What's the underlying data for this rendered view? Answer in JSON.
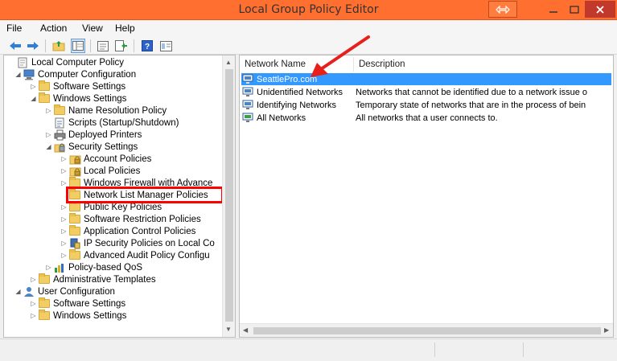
{
  "window": {
    "title": "Local Group Policy Editor"
  },
  "menu": [
    "File",
    "Action",
    "View",
    "Help"
  ],
  "toolbar": [
    "back-icon",
    "forward-icon",
    "up-folder-icon",
    "show-tree-icon",
    "properties-icon",
    "export-list-icon",
    "help-icon",
    "extended-view-icon"
  ],
  "tree": [
    {
      "label": "Local Computer Policy",
      "expander": "",
      "icon": "policy",
      "indent": 0
    },
    {
      "label": "Computer Configuration",
      "expander": "◢",
      "icon": "computer",
      "indent": 1
    },
    {
      "label": "Software Settings",
      "expander": "▷",
      "icon": "folder",
      "indent": 2
    },
    {
      "label": "Windows Settings",
      "expander": "◢",
      "icon": "folder",
      "indent": 2
    },
    {
      "label": "Name Resolution Policy",
      "expander": "▷",
      "icon": "folder",
      "indent": 3
    },
    {
      "label": "Scripts (Startup/Shutdown)",
      "expander": "",
      "icon": "script",
      "indent": 3
    },
    {
      "label": "Deployed Printers",
      "expander": "▷",
      "icon": "printer",
      "indent": 3
    },
    {
      "label": "Security Settings",
      "expander": "◢",
      "icon": "security",
      "indent": 3
    },
    {
      "label": "Account Policies",
      "expander": "▷",
      "icon": "folder-lock",
      "indent": 4
    },
    {
      "label": "Local Policies",
      "expander": "▷",
      "icon": "folder-lock",
      "indent": 4
    },
    {
      "label": "Windows Firewall with Advance",
      "expander": "▷",
      "icon": "folder",
      "indent": 4
    },
    {
      "label": "Network List Manager Policies",
      "expander": "",
      "icon": "folder",
      "indent": 4
    },
    {
      "label": "Public Key Policies",
      "expander": "▷",
      "icon": "folder",
      "indent": 4
    },
    {
      "label": "Software Restriction Policies",
      "expander": "▷",
      "icon": "folder",
      "indent": 4
    },
    {
      "label": "Application Control Policies",
      "expander": "▷",
      "icon": "folder",
      "indent": 4
    },
    {
      "label": "IP Security Policies on Local Co",
      "expander": "▷",
      "icon": "ipsec",
      "indent": 4
    },
    {
      "label": "Advanced Audit Policy Configu",
      "expander": "▷",
      "icon": "folder",
      "indent": 4
    },
    {
      "label": "Policy-based QoS",
      "expander": "▷",
      "icon": "chart",
      "indent": 3
    },
    {
      "label": "Administrative Templates",
      "expander": "▷",
      "icon": "folder",
      "indent": 2
    },
    {
      "label": "User Configuration",
      "expander": "◢",
      "icon": "user",
      "indent": 1
    },
    {
      "label": "Software Settings",
      "expander": "▷",
      "icon": "folder",
      "indent": 2
    },
    {
      "label": "Windows Settings",
      "expander": "▷",
      "icon": "folder",
      "indent": 2
    }
  ],
  "list": {
    "columns": [
      "Network Name",
      "Description"
    ],
    "rows": [
      {
        "name": "SeattlePro.com",
        "description": "",
        "selected": true
      },
      {
        "name": "Unidentified Networks",
        "description": "Networks that cannot be identified due to a network issue o",
        "selected": false
      },
      {
        "name": "Identifying Networks",
        "description": "Temporary state of networks that are in the process of bein",
        "selected": false
      },
      {
        "name": "All Networks",
        "description": "All networks that a user connects to.",
        "selected": false
      }
    ]
  },
  "colors": {
    "titlebar": "#ff6f2f",
    "selection": "#3399ff",
    "highlight": "#ff0000",
    "arrow": "#e8201c"
  }
}
